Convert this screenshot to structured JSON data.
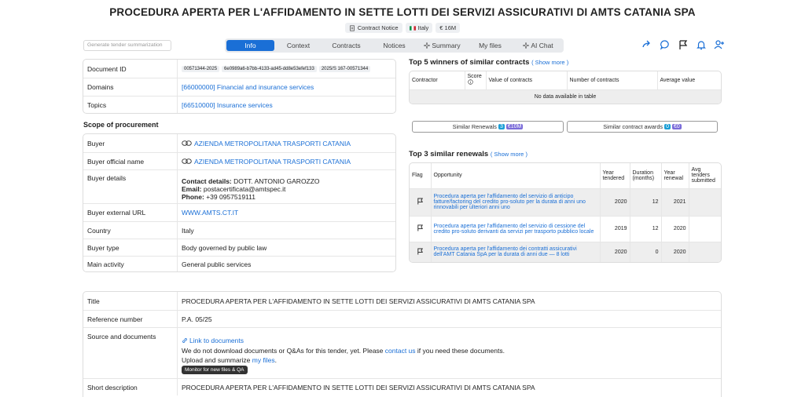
{
  "title": "PROCEDURA APERTA PER L'AFFIDAMENTO IN SETTE LOTTI DEI SERVIZI ASSICURATIVI DI AMTS CATANIA SPA",
  "meta": {
    "type": "Contract Notice",
    "country": "Italy",
    "value": "€ 16M",
    "flag_colors": [
      "#009246",
      "#ffffff",
      "#ce2b37"
    ]
  },
  "summarize_placeholder": "Generate tender summarization",
  "tabs": [
    "Info",
    "Context",
    "Contracts",
    "Notices",
    "Summary",
    "My files",
    "AI Chat"
  ],
  "details": {
    "document_id_label": "Document ID",
    "document_ids": [
      "00571344-2025",
      "6e0989a6-b7bb-4133-ad45-dd8e53efef133",
      "2025/S 167-00571344"
    ],
    "domains_label": "Domains",
    "domains_value": "[66000000] Financial and insurance services",
    "topics_label": "Topics",
    "topics_value": "[66510000] Insurance services"
  },
  "scope_heading": "Scope of procurement",
  "buyer": {
    "buyer_label": "Buyer",
    "buyer_value": "AZIENDA METROPOLITANA TRASPORTI CATANIA",
    "official_label": "Buyer official name",
    "official_value": "AZIENDA METROPOLITANA TRASPORTI CATANIA",
    "details_label": "Buyer details",
    "contact_label": "Contact details:",
    "contact_value": "DOTT. ANTONIO GAROZZO",
    "email_label": "Email:",
    "email_value": "postacertificata@amtspec.it",
    "phone_label": "Phone:",
    "phone_value": "+39 0957519111",
    "url_label": "Buyer external URL",
    "url_value": "WWW.AMTS.CT.IT",
    "country_label": "Country",
    "country_value": "Italy",
    "type_label": "Buyer type",
    "type_value": "Body governed by public law",
    "activity_label": "Main activity",
    "activity_value": "General public services"
  },
  "winners": {
    "heading": "Top 5 winners of similar contracts",
    "show_more": "( Show more )",
    "columns": [
      "Contractor",
      "Score",
      "Value of contracts",
      "Number of contracts",
      "Average value"
    ],
    "empty": "No data available in table"
  },
  "similar": {
    "renewals_label": "Similar Renewals",
    "renewals_count": "3",
    "renewals_value": "€10M",
    "awards_label": "Similar contract awards",
    "awards_count": "0",
    "awards_value": "€0"
  },
  "renewals": {
    "heading": "Top 3 similar renewals",
    "show_more": "( Show more )",
    "columns": [
      "Flag",
      "Opportunity",
      "Year tendered",
      "Duration (months)",
      "Year renewal",
      "Avg tenders submitted"
    ],
    "rows": [
      {
        "opportunity": "Procedura aperta per l'affidamento del servizio di anticipo fatture/factoring del credito pro-soluto per la durata di anni uno rinnovabili per ulteriori anni uno",
        "year": "2020",
        "duration": "12",
        "renewal": "2021",
        "avg": ""
      },
      {
        "opportunity": "Procedura aperta per l'affidamento del servizio di cessione del credito pro-soluto derivanti da servizi per trasporto pubblico locale",
        "year": "2019",
        "duration": "12",
        "renewal": "2020",
        "avg": ""
      },
      {
        "opportunity": "Procedura aperta per l'affidamento dei contratti assicurativi dell'AMT Catania SpA per la durata di anni due — 8 lotti",
        "year": "2020",
        "duration": "0",
        "renewal": "2020",
        "avg": ""
      }
    ]
  },
  "bottom": {
    "title_label": "Title",
    "title_value": "PROCEDURA APERTA PER L'AFFIDAMENTO IN SETTE LOTTI DEI SERVIZI ASSICURATIVI DI AMTS CATANIA SPA",
    "ref_label": "Reference number",
    "ref_value": "P.A. 05/25",
    "source_label": "Source and documents",
    "link_docs": "Link to documents",
    "no_download_text": "We do not download documents or Q&As for this tender, yet. Please",
    "contact_us": "contact us",
    "no_download_tail": "if you need these documents.",
    "upload_text": "Upload and summarize",
    "my_files": "my files",
    "monitor_btn": "Monitor for new files & QA",
    "short_desc_label": "Short description",
    "short_desc_value": "PROCEDURA APERTA PER L'AFFIDAMENTO IN SETTE LOTTI DEI SERVIZI ASSICURATIVI DI AMTS CATANIA SPA"
  }
}
